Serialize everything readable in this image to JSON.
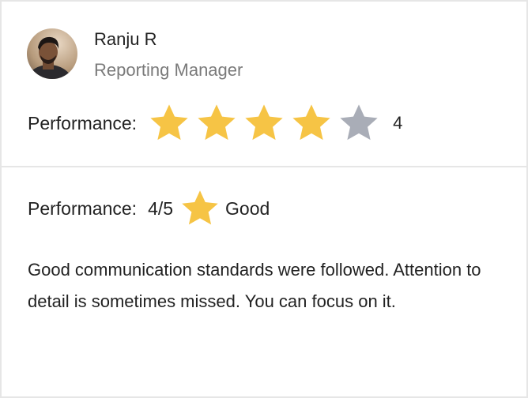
{
  "reviewer": {
    "name": "Ranju R",
    "role": "Reporting Manager",
    "avatar_icon": "person-avatar"
  },
  "rating": {
    "label": "Performance:",
    "value": 4,
    "max": 5,
    "value_text": "4",
    "filled_color": "#F6C445",
    "empty_color": "#A9ADB7"
  },
  "summary": {
    "label": "Performance:",
    "score_text": "4/5",
    "descriptor": "Good",
    "star_color": "#F6C445"
  },
  "comment": {
    "text": "Good communication standards were followed. Attention to detail is sometimes missed. You can focus on it."
  }
}
